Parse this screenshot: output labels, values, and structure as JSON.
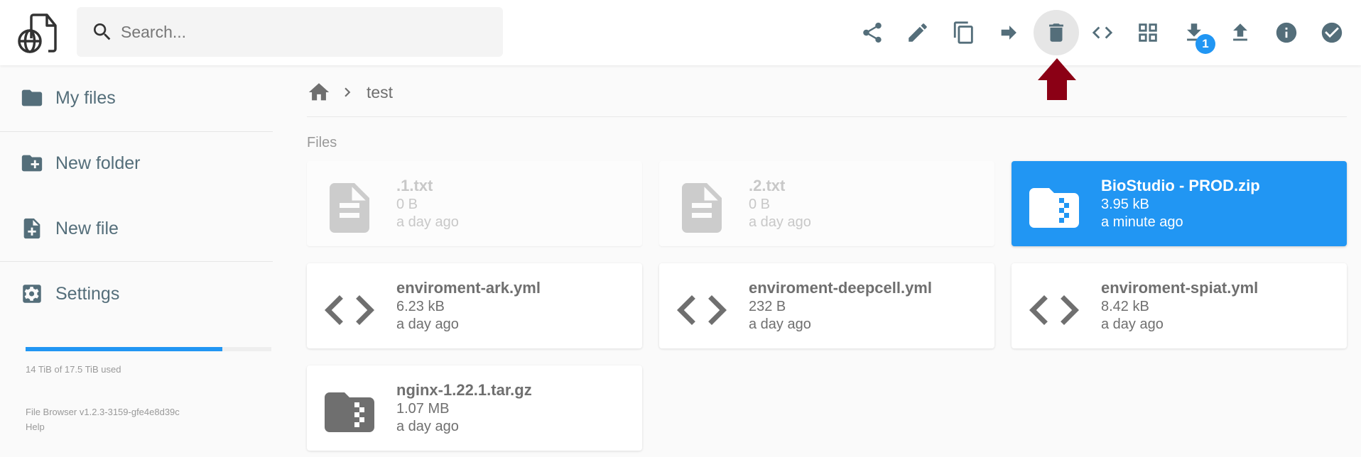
{
  "header": {
    "search": {
      "placeholder": "Search...",
      "value": ""
    },
    "toolbar": [
      {
        "id": "share",
        "icon": "share-icon",
        "label": "Share"
      },
      {
        "id": "rename",
        "icon": "pencil-icon",
        "label": "Rename"
      },
      {
        "id": "copy",
        "icon": "copy-icon",
        "label": "Copy"
      },
      {
        "id": "move",
        "icon": "arrow-right-icon",
        "label": "Move"
      },
      {
        "id": "delete",
        "icon": "trash-icon",
        "label": "Delete",
        "hovered": true
      },
      {
        "id": "switch-view",
        "icon": "code-icon",
        "label": "Switch view"
      },
      {
        "id": "grid",
        "icon": "grid-icon",
        "label": "Grid view"
      },
      {
        "id": "download",
        "icon": "download-icon",
        "label": "Download",
        "badge": "1"
      },
      {
        "id": "upload",
        "icon": "upload-icon",
        "label": "Upload"
      },
      {
        "id": "info",
        "icon": "info-icon",
        "label": "Info"
      },
      {
        "id": "select",
        "icon": "check-circle-icon",
        "label": "Select multiple"
      }
    ]
  },
  "annotation": {
    "icon": "arrow-up-icon",
    "color": "#8b0015"
  },
  "sidebar": {
    "items": [
      {
        "label": "My files",
        "icon": "folder-icon"
      },
      {
        "label": "New folder",
        "icon": "create-new-folder-icon"
      },
      {
        "label": "New file",
        "icon": "note-add-icon"
      },
      {
        "label": "Settings",
        "icon": "settings-icon"
      }
    ],
    "usage": {
      "text": "14 TiB of 17.5 TiB used",
      "used_fraction": 0.8
    },
    "version": "File Browser v1.2.3-3159-gfe4e8d39c",
    "help": "Help"
  },
  "breadcrumb": {
    "home_icon": "home-icon",
    "items": [
      "test"
    ]
  },
  "section_title": "Files",
  "files": [
    {
      "name": ".1.txt",
      "size": "0 B",
      "modified": "a day ago",
      "type": "text",
      "state": "hidden"
    },
    {
      "name": ".2.txt",
      "size": "0 B",
      "modified": "a day ago",
      "type": "text",
      "state": "hidden"
    },
    {
      "name": "BioStudio - PROD.zip",
      "size": "3.95 kB",
      "modified": "a minute ago",
      "type": "archive",
      "state": "selected"
    },
    {
      "name": "enviroment-ark.yml",
      "size": "6.23 kB",
      "modified": "a day ago",
      "type": "code",
      "state": "normal"
    },
    {
      "name": "enviroment-deepcell.yml",
      "size": "232 B",
      "modified": "a day ago",
      "type": "code",
      "state": "normal"
    },
    {
      "name": "enviroment-spiat.yml",
      "size": "8.42 kB",
      "modified": "a day ago",
      "type": "code",
      "state": "normal"
    },
    {
      "name": "nginx-1.22.1.tar.gz",
      "size": "1.07 MB",
      "modified": "a day ago",
      "type": "archive",
      "state": "normal"
    }
  ],
  "colors": {
    "accent": "#2196f3",
    "icon": "#546e7a",
    "file_icon": "#6f6f6f",
    "hidden": "#cccccc"
  }
}
